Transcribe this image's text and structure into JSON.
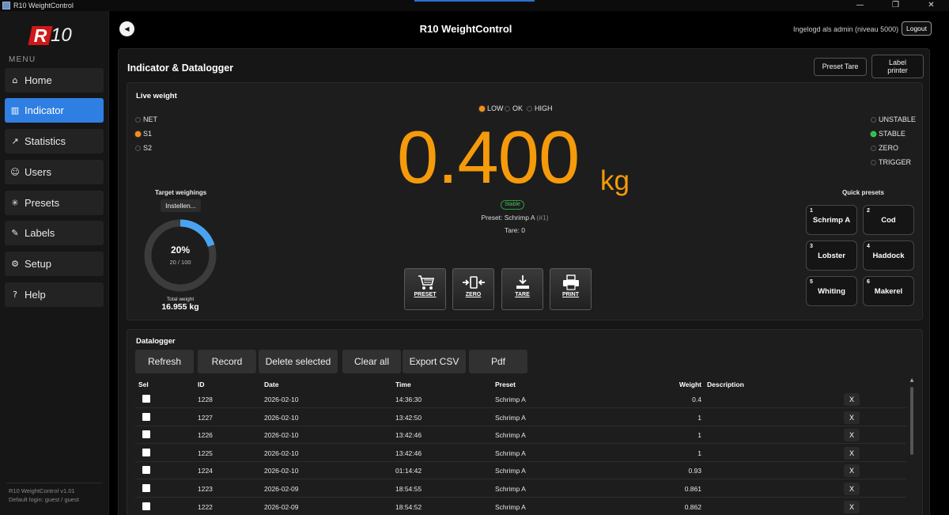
{
  "window": {
    "title": "R10 WeightControl"
  },
  "sidebar": {
    "logo_letter": "R",
    "logo_number": "10",
    "menu_label": "MENU",
    "items": [
      {
        "label": "Home",
        "icon": "home-icon",
        "glyph": "⌂"
      },
      {
        "label": "Indicator",
        "icon": "bar-chart-icon",
        "glyph": "▥",
        "active": true
      },
      {
        "label": "Statistics",
        "icon": "line-chart-icon",
        "glyph": "↗"
      },
      {
        "label": "Users",
        "icon": "users-icon",
        "glyph": "☺"
      },
      {
        "label": "Presets",
        "icon": "sparkle-icon",
        "glyph": "✳"
      },
      {
        "label": "Labels",
        "icon": "edit-icon",
        "glyph": "✎"
      },
      {
        "label": "Setup",
        "icon": "gear-icon",
        "glyph": "⚙"
      },
      {
        "label": "Help",
        "icon": "help-icon",
        "glyph": "?"
      }
    ],
    "version": "R10 WeightControl v1.01",
    "default_login": "Default login: guest  /  guest"
  },
  "header": {
    "title": "R10 WeightControl",
    "user_info": "Ingelogd als admin (niveau 5000)",
    "logout_label": "Logout",
    "back_glyph": "◀"
  },
  "panel": {
    "title": "Indicator & Datalogger",
    "preset_tare_label": "Preset Tare",
    "label_printer_line1": "Label",
    "label_printer_line2": "printer"
  },
  "live": {
    "title": "Live weight",
    "mode_options": [
      {
        "label": "NET",
        "selected": false
      },
      {
        "label": "S1",
        "selected": true
      },
      {
        "label": "S2",
        "selected": false
      }
    ],
    "limit_options": [
      {
        "label": "LOW",
        "selected": true
      },
      {
        "label": "OK",
        "selected": false
      },
      {
        "label": "HIGH",
        "selected": false
      }
    ],
    "status_options": [
      {
        "label": "UNSTABLE",
        "selected": false
      },
      {
        "label": "STABLE",
        "selected": true
      },
      {
        "label": "ZERO",
        "selected": false
      },
      {
        "label": "TRIGGER",
        "selected": false
      }
    ],
    "weight": "0.400",
    "unit": "kg",
    "stable_badge": "Stable",
    "preset_text": "Preset: Schrimp A",
    "preset_id": "(#1)",
    "tare_text": "Tare: 0",
    "accent_color": "#f59a0a",
    "target": {
      "title": "Target weighings",
      "set_label": "Instellen...",
      "percent_label": "20%",
      "progress": 0.2,
      "count": "20 / 100",
      "total_label": "Total weight",
      "total_value": "16.955 kg"
    },
    "actions": [
      {
        "label": "PRESET",
        "icon": "cart-icon"
      },
      {
        "label": "ZERO",
        "icon": "zero-icon"
      },
      {
        "label": "TARE",
        "icon": "tare-icon"
      },
      {
        "label": "PRINT",
        "icon": "printer-icon"
      }
    ],
    "quick_presets_title": "Quick presets",
    "quick_presets": [
      {
        "num": "1",
        "label": "Schrimp A"
      },
      {
        "num": "2",
        "label": "Cod"
      },
      {
        "num": "3",
        "label": "Lobster"
      },
      {
        "num": "4",
        "label": "Haddock"
      },
      {
        "num": "5",
        "label": "Whiting"
      },
      {
        "num": "6",
        "label": "Makerel"
      }
    ]
  },
  "datalogger": {
    "title": "Datalogger",
    "buttons": [
      "Refresh",
      "Record",
      "Delete selected",
      "Clear all",
      "Export CSV",
      "Pdf"
    ],
    "columns": [
      "Sel",
      "ID",
      "Date",
      "Time",
      "Preset",
      "Weight",
      "Description"
    ],
    "delete_glyph": "X",
    "rows": [
      {
        "id": "1228",
        "date": "2026-02-10",
        "time": "14:36:30",
        "preset": "Schrimp A",
        "weight": "0.4",
        "description": ""
      },
      {
        "id": "1227",
        "date": "2026-02-10",
        "time": "13:42:50",
        "preset": "Schrimp A",
        "weight": "1",
        "description": ""
      },
      {
        "id": "1226",
        "date": "2026-02-10",
        "time": "13:42:46",
        "preset": "Schrimp A",
        "weight": "1",
        "description": ""
      },
      {
        "id": "1225",
        "date": "2026-02-10",
        "time": "13:42:46",
        "preset": "Schrimp A",
        "weight": "1",
        "description": ""
      },
      {
        "id": "1224",
        "date": "2026-02-10",
        "time": "01:14:42",
        "preset": "Schrimp A",
        "weight": "0.93",
        "description": ""
      },
      {
        "id": "1223",
        "date": "2026-02-09",
        "time": "18:54:55",
        "preset": "Schrimp A",
        "weight": "0.861",
        "description": ""
      },
      {
        "id": "1222",
        "date": "2026-02-09",
        "time": "18:54:52",
        "preset": "Schrimp A",
        "weight": "0.862",
        "description": ""
      }
    ]
  }
}
